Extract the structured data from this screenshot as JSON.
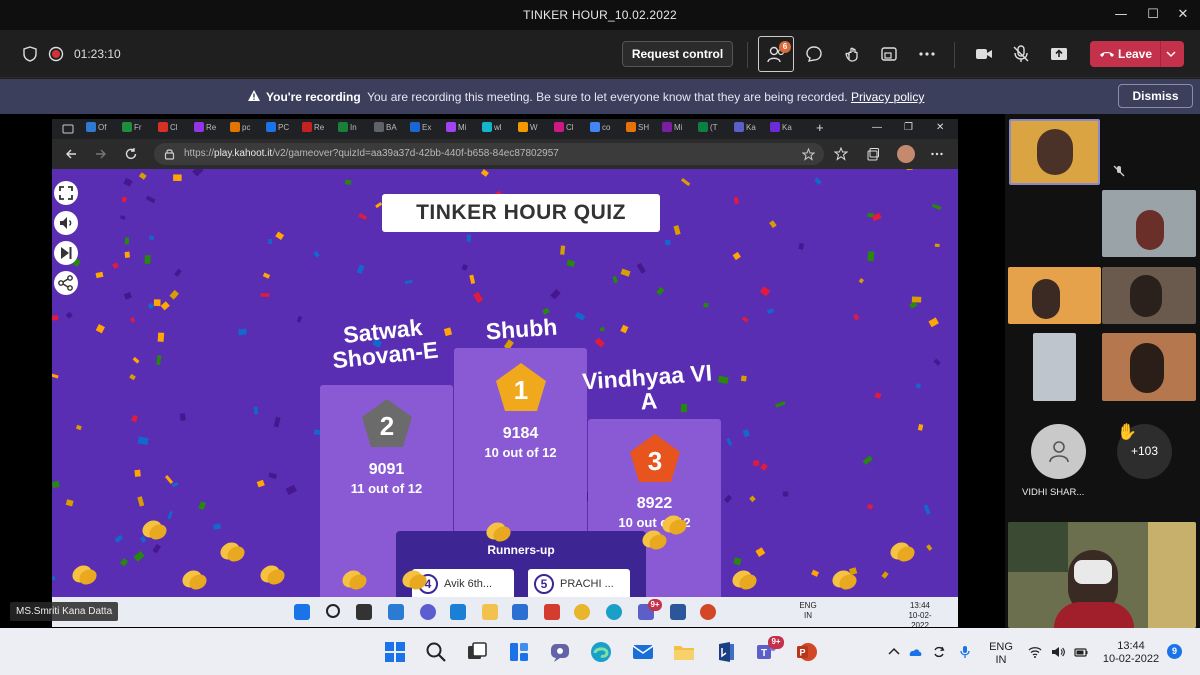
{
  "window": {
    "title": "TINKER HOUR_10.02.2022",
    "controls": {
      "minimize": "—",
      "maximize": "☐",
      "close": "✕"
    }
  },
  "toolbar": {
    "timer": "01:23:10",
    "request_control_label": "Request control",
    "participants_badge": "6",
    "leave_label": "Leave"
  },
  "banner": {
    "bold": "You're recording",
    "message": "You are recording this meeting. Be sure to let everyone know that they are being recorded.",
    "link": "Privacy policy",
    "dismiss_label": "Dismiss"
  },
  "stage": {
    "presenter_label": "MS.Smriti Kana Datta"
  },
  "browser": {
    "tabs": [
      "Of",
      "Fr",
      "Cl",
      "Re",
      "pc",
      "PC",
      "Re",
      "In",
      "BA",
      "Ex",
      "Mi",
      "wl",
      "W",
      "Cl",
      "co",
      "SH",
      "Mi",
      "(T",
      "Ka",
      "Ka"
    ],
    "url_prefix": "https://",
    "url_host": "play.kahoot.it",
    "url_path": "/v2/gameover?quizId=aa39a37d-42bb-440f-b658-84ec87802957",
    "new_tab": "+"
  },
  "kahoot": {
    "quiz_title": "TINKER HOUR QUIZ",
    "podium": [
      {
        "rank": "1",
        "name": "Shubh",
        "score": "9184",
        "correct": "10 out of 12"
      },
      {
        "rank": "2",
        "name_line1": "Satwak",
        "name_line2": "Shovan-E",
        "score": "9091",
        "correct": "11 out of 12"
      },
      {
        "rank": "3",
        "name_line1": "Vindhyaa VI",
        "name_line2": "A",
        "score": "8922",
        "correct": "10 out of 12"
      }
    ],
    "runners_up_label": "Runners-up",
    "runners_up": [
      {
        "rank": "4",
        "name": "Avik 6th..."
      },
      {
        "rank": "5",
        "name": "PRACHI ..."
      }
    ]
  },
  "inner_taskbar": {
    "lang_top": "ENG",
    "lang_bottom": "IN",
    "time": "13:44",
    "date": "10-02-2022",
    "teams_badge": "9+"
  },
  "roster": {
    "participant_name": "VIDHI SHAR...",
    "more_count": "+103",
    "raised_hand": "✋"
  },
  "taskbar": {
    "lang_top": "ENG",
    "lang_bottom": "IN",
    "time": "13:44",
    "date": "10-02-2022",
    "notification_count": "9",
    "teams_badge": "9+"
  },
  "colors": {
    "kahoot_purple": "#5a2eb2",
    "podium": "#8a5ad4",
    "gold": "#f0a81c",
    "silver": "#6b6b6b",
    "bronze": "#e8541e",
    "leave_red": "#c4314b",
    "banner": "#3c3f5c"
  }
}
